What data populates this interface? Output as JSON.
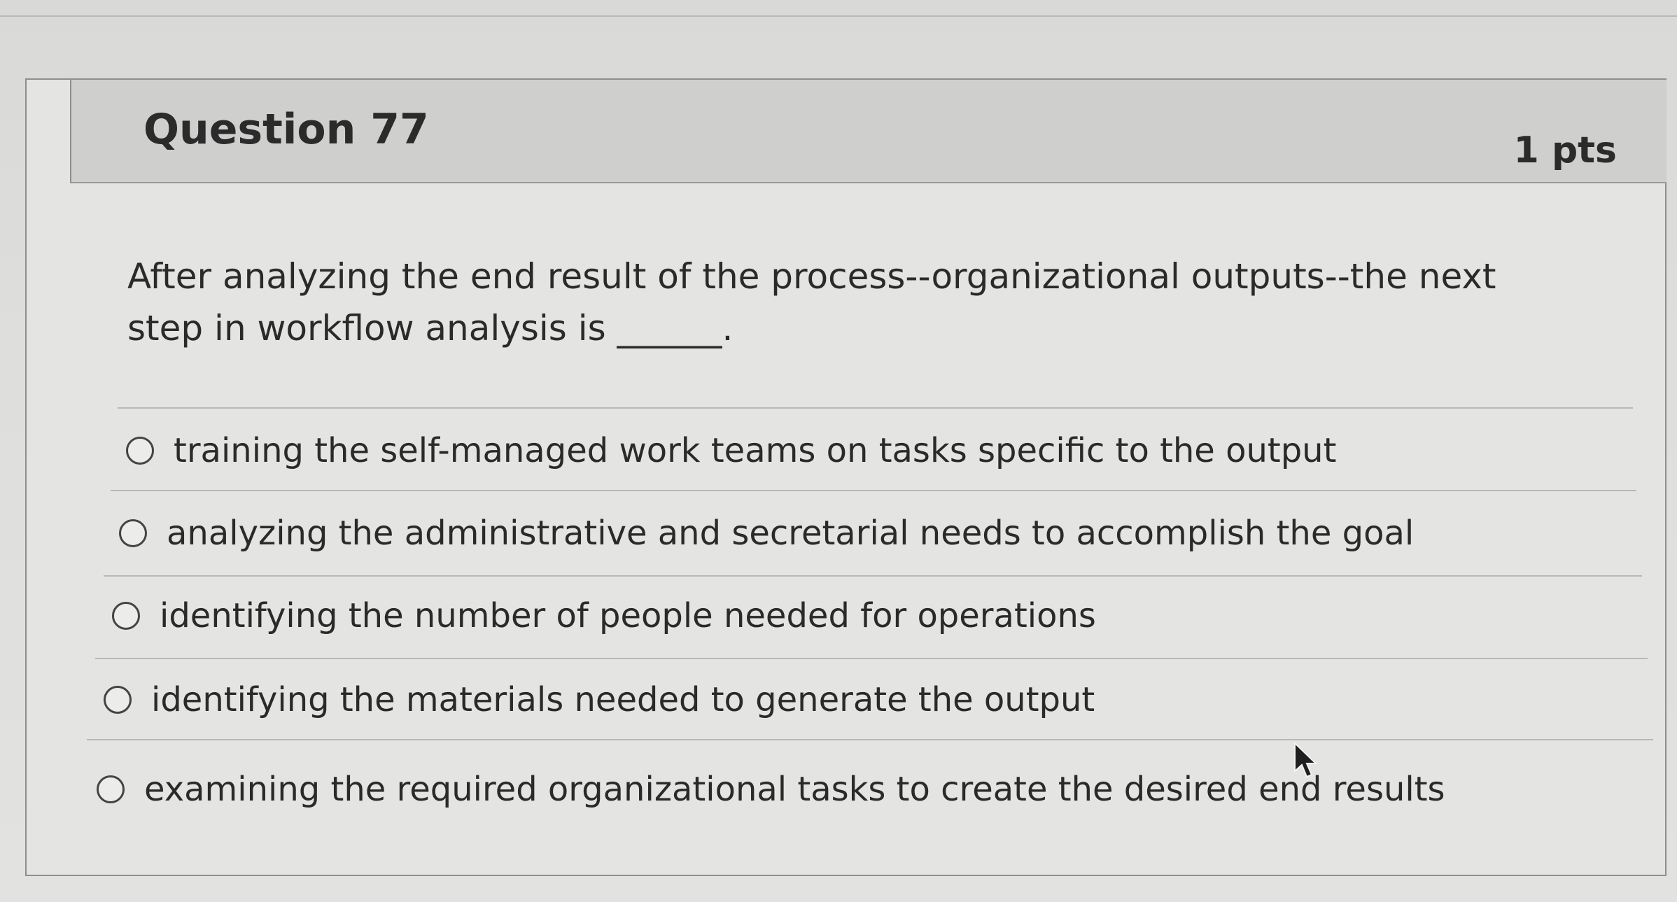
{
  "question": {
    "title": "Question 77",
    "points": "1 pts",
    "prompt": "After analyzing the end result of the process--organizational outputs--the next step in workflow analysis is ______."
  },
  "answers": [
    {
      "label": "training the self-managed work teams on tasks specific to the output",
      "selected": false
    },
    {
      "label": "analyzing the administrative and secretarial needs to accomplish the goal",
      "selected": false
    },
    {
      "label": "identifying the number of people needed for operations",
      "selected": false
    },
    {
      "label": "identifying the materials needed to generate the output",
      "selected": false
    },
    {
      "label": "examining the required organizational tasks to create the desired end results",
      "selected": false
    }
  ],
  "icons": {
    "cursor": "mouse-pointer-icon",
    "radio": "radio-button-icon"
  }
}
